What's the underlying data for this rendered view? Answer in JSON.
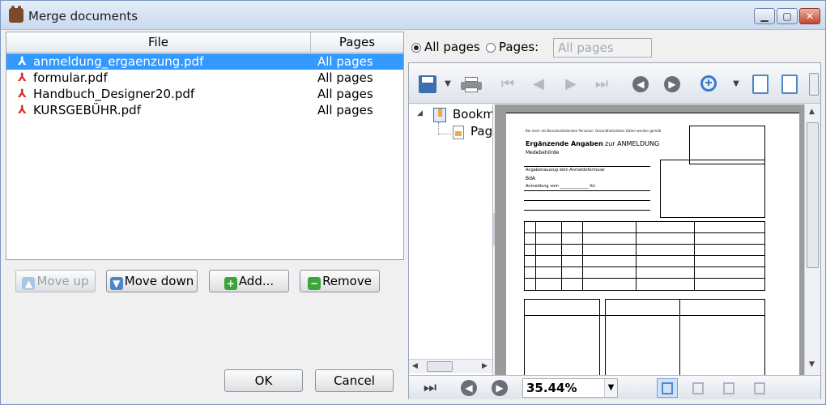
{
  "window": {
    "title": "Merge documents",
    "minimize": "▁",
    "maximize": "▢",
    "close": "✕"
  },
  "file_list": {
    "headers": {
      "file": "File",
      "pages": "Pages"
    },
    "rows": [
      {
        "name": "anmeldung_ergaenzung.pdf",
        "pages": "All pages",
        "selected": true
      },
      {
        "name": "formular.pdf",
        "pages": "All pages",
        "selected": false
      },
      {
        "name": "Handbuch_Designer20.pdf",
        "pages": "All pages",
        "selected": false
      },
      {
        "name": "KURSGEBÜHR.pdf",
        "pages": "All pages",
        "selected": false
      }
    ]
  },
  "buttons": {
    "move_up": "Move up",
    "move_down": "Move down",
    "add": "Add...",
    "remove": "Remove",
    "ok": "OK",
    "cancel": "Cancel"
  },
  "page_selection": {
    "all_pages_label": "All pages",
    "pages_label": "Pages:",
    "pages_value": "All pages",
    "selected": "all"
  },
  "viewer": {
    "tree": {
      "bookmarks": "Bookm",
      "pages": "Pag"
    },
    "zoom": "35.44%",
    "page_doc": {
      "heading": "Ergänzende Angaben",
      "heading_suffix": "zur ANMELDUNG",
      "sub": "Medebehörde",
      "section": "Angabenauszug dem Anmeldeformular",
      "company": "BdA",
      "row_label": "Anmeldung vom ______________ für"
    }
  },
  "colors": {
    "selection": "#3399ff",
    "accent": "#4a88c8"
  }
}
